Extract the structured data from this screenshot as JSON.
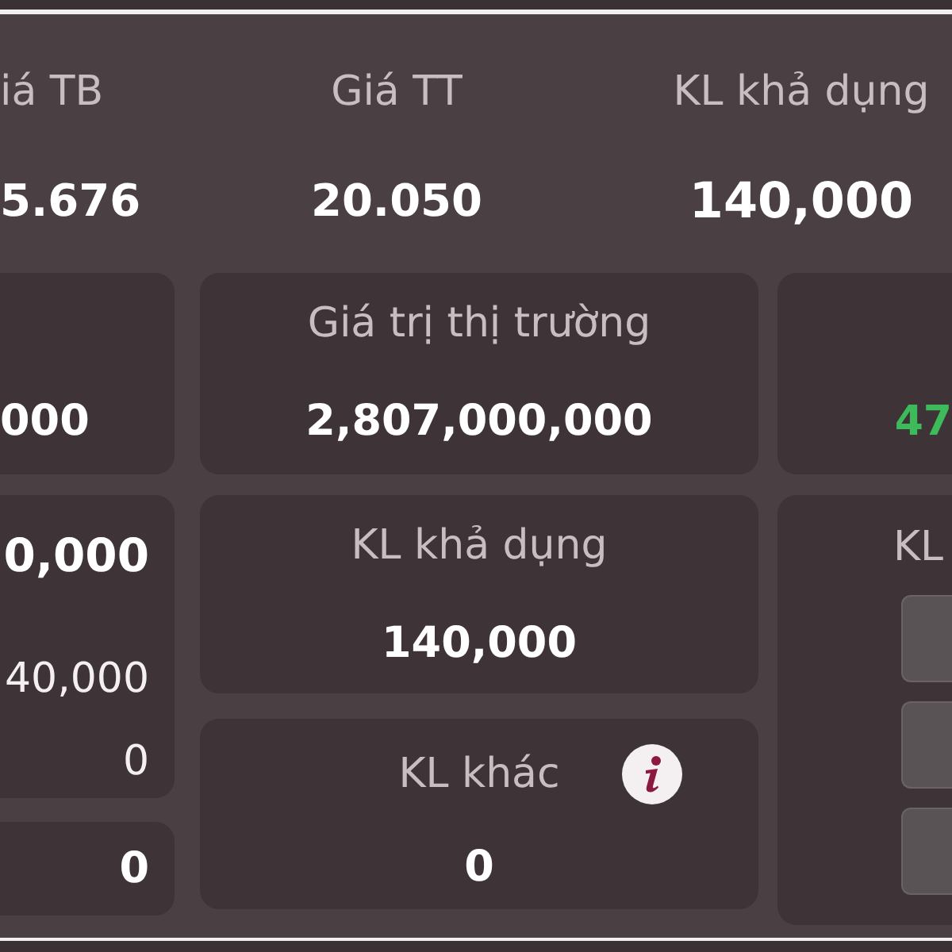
{
  "summary": [
    {
      "label": "iá TB",
      "value": "5.676"
    },
    {
      "label": "Giá TT",
      "value": "20.050"
    },
    {
      "label": "KL khả dụng",
      "value": "140,000"
    }
  ],
  "left_column": {
    "cards": [
      {
        "kind": "value",
        "value": "000"
      },
      {
        "kind": "breakdown",
        "total": "0,000",
        "rows": [
          "40,000",
          "0"
        ]
      },
      {
        "kind": "value",
        "value": "0"
      }
    ]
  },
  "middle_column": {
    "cards": [
      {
        "label": "Giá trị thị trường",
        "value": "2,807,000,000",
        "info": false
      },
      {
        "label": "KL khả dụng",
        "value": "140,000",
        "info": false
      },
      {
        "label": "KL khác",
        "value": "0",
        "info": true
      }
    ]
  },
  "right_column": {
    "cards": [
      {
        "kind": "value",
        "value": "47",
        "color": "#3dbb5a"
      },
      {
        "kind": "buttons",
        "label": "KL",
        "buttons": [
          {
            "kind": "blank"
          },
          {
            "kind": "blank"
          },
          {
            "kind": "blank"
          }
        ]
      }
    ]
  }
}
